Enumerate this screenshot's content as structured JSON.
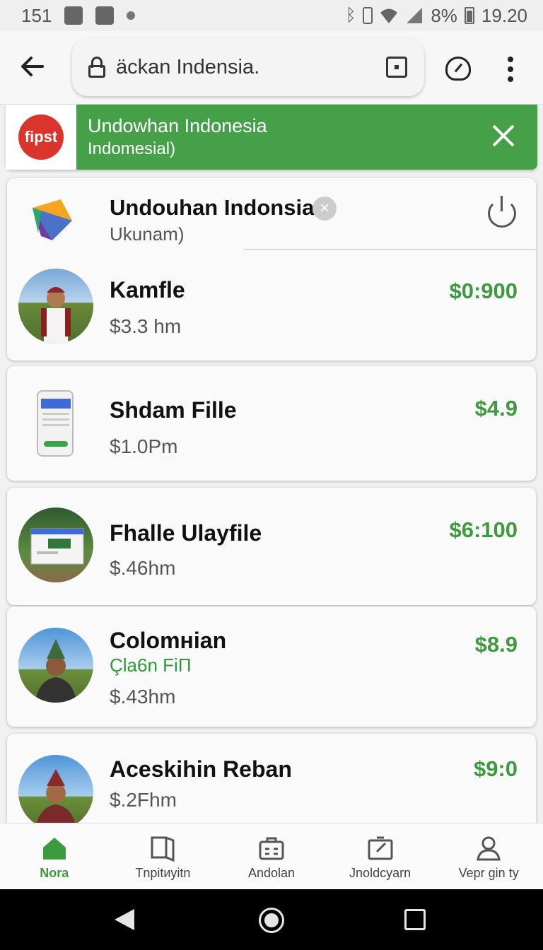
{
  "status_bar": {
    "left_text": "151",
    "battery": "8%",
    "time": "19.20"
  },
  "address_bar": {
    "url": "äckan Indensia."
  },
  "banner": {
    "logo_text": "fipst",
    "title": "Undowhan Indonesia",
    "subtitle": "Indomesial)",
    "accent_color": "#45a047"
  },
  "app_header": {
    "title": "Undouhan Indonsia",
    "subtitle": "Ukunam)"
  },
  "items": [
    {
      "name": "Kamfle",
      "meta": "$3.3 hm",
      "price": "$0:900"
    },
    {
      "name": "Shdam Fille",
      "meta": "$1.0Pm",
      "price": "$4.9"
    },
    {
      "name": "Fhalle Ulayfile",
      "meta": "$.46hm",
      "price": "$6:100"
    },
    {
      "name": "Colomнian",
      "sub": "Çla6n FiП",
      "meta": "$.43hm",
      "price": "$8.9"
    },
    {
      "name": "Aceskihin Reban",
      "meta": "$.2Fhm",
      "price": "$9:0"
    }
  ],
  "bottom_nav": [
    {
      "label": "Nora",
      "icon": "home-icon"
    },
    {
      "label": "Tnpitиyitn",
      "icon": "book-icon"
    },
    {
      "label": "Andolan",
      "icon": "briefcase-icon"
    },
    {
      "label": "Jnoldcyarn",
      "icon": "edit-box-icon"
    },
    {
      "label": "Vepr gin ty",
      "icon": "person-icon"
    }
  ]
}
